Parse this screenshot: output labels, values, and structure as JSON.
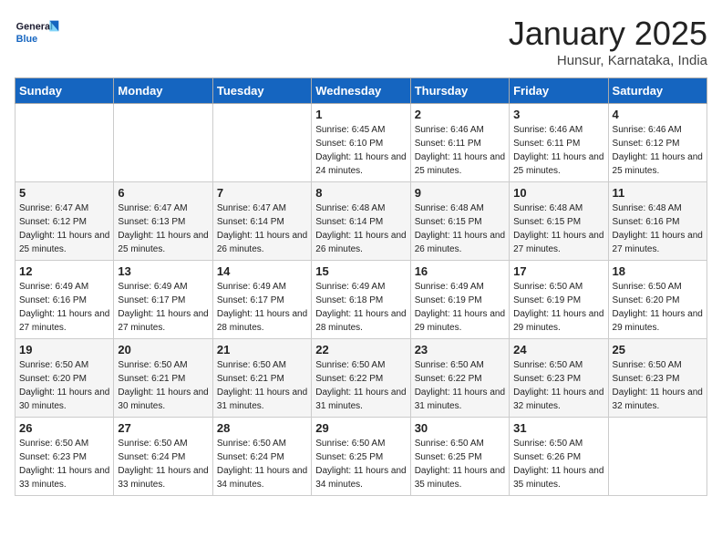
{
  "header": {
    "logo_general": "General",
    "logo_blue": "Blue",
    "month": "January 2025",
    "location": "Hunsur, Karnataka, India"
  },
  "weekdays": [
    "Sunday",
    "Monday",
    "Tuesday",
    "Wednesday",
    "Thursday",
    "Friday",
    "Saturday"
  ],
  "weeks": [
    [
      {
        "day": "",
        "info": ""
      },
      {
        "day": "",
        "info": ""
      },
      {
        "day": "",
        "info": ""
      },
      {
        "day": "1",
        "info": "Sunrise: 6:45 AM\nSunset: 6:10 PM\nDaylight: 11 hours and 24 minutes."
      },
      {
        "day": "2",
        "info": "Sunrise: 6:46 AM\nSunset: 6:11 PM\nDaylight: 11 hours and 25 minutes."
      },
      {
        "day": "3",
        "info": "Sunrise: 6:46 AM\nSunset: 6:11 PM\nDaylight: 11 hours and 25 minutes."
      },
      {
        "day": "4",
        "info": "Sunrise: 6:46 AM\nSunset: 6:12 PM\nDaylight: 11 hours and 25 minutes."
      }
    ],
    [
      {
        "day": "5",
        "info": "Sunrise: 6:47 AM\nSunset: 6:12 PM\nDaylight: 11 hours and 25 minutes."
      },
      {
        "day": "6",
        "info": "Sunrise: 6:47 AM\nSunset: 6:13 PM\nDaylight: 11 hours and 25 minutes."
      },
      {
        "day": "7",
        "info": "Sunrise: 6:47 AM\nSunset: 6:14 PM\nDaylight: 11 hours and 26 minutes."
      },
      {
        "day": "8",
        "info": "Sunrise: 6:48 AM\nSunset: 6:14 PM\nDaylight: 11 hours and 26 minutes."
      },
      {
        "day": "9",
        "info": "Sunrise: 6:48 AM\nSunset: 6:15 PM\nDaylight: 11 hours and 26 minutes."
      },
      {
        "day": "10",
        "info": "Sunrise: 6:48 AM\nSunset: 6:15 PM\nDaylight: 11 hours and 27 minutes."
      },
      {
        "day": "11",
        "info": "Sunrise: 6:48 AM\nSunset: 6:16 PM\nDaylight: 11 hours and 27 minutes."
      }
    ],
    [
      {
        "day": "12",
        "info": "Sunrise: 6:49 AM\nSunset: 6:16 PM\nDaylight: 11 hours and 27 minutes."
      },
      {
        "day": "13",
        "info": "Sunrise: 6:49 AM\nSunset: 6:17 PM\nDaylight: 11 hours and 27 minutes."
      },
      {
        "day": "14",
        "info": "Sunrise: 6:49 AM\nSunset: 6:17 PM\nDaylight: 11 hours and 28 minutes."
      },
      {
        "day": "15",
        "info": "Sunrise: 6:49 AM\nSunset: 6:18 PM\nDaylight: 11 hours and 28 minutes."
      },
      {
        "day": "16",
        "info": "Sunrise: 6:49 AM\nSunset: 6:19 PM\nDaylight: 11 hours and 29 minutes."
      },
      {
        "day": "17",
        "info": "Sunrise: 6:50 AM\nSunset: 6:19 PM\nDaylight: 11 hours and 29 minutes."
      },
      {
        "day": "18",
        "info": "Sunrise: 6:50 AM\nSunset: 6:20 PM\nDaylight: 11 hours and 29 minutes."
      }
    ],
    [
      {
        "day": "19",
        "info": "Sunrise: 6:50 AM\nSunset: 6:20 PM\nDaylight: 11 hours and 30 minutes."
      },
      {
        "day": "20",
        "info": "Sunrise: 6:50 AM\nSunset: 6:21 PM\nDaylight: 11 hours and 30 minutes."
      },
      {
        "day": "21",
        "info": "Sunrise: 6:50 AM\nSunset: 6:21 PM\nDaylight: 11 hours and 31 minutes."
      },
      {
        "day": "22",
        "info": "Sunrise: 6:50 AM\nSunset: 6:22 PM\nDaylight: 11 hours and 31 minutes."
      },
      {
        "day": "23",
        "info": "Sunrise: 6:50 AM\nSunset: 6:22 PM\nDaylight: 11 hours and 31 minutes."
      },
      {
        "day": "24",
        "info": "Sunrise: 6:50 AM\nSunset: 6:23 PM\nDaylight: 11 hours and 32 minutes."
      },
      {
        "day": "25",
        "info": "Sunrise: 6:50 AM\nSunset: 6:23 PM\nDaylight: 11 hours and 32 minutes."
      }
    ],
    [
      {
        "day": "26",
        "info": "Sunrise: 6:50 AM\nSunset: 6:23 PM\nDaylight: 11 hours and 33 minutes."
      },
      {
        "day": "27",
        "info": "Sunrise: 6:50 AM\nSunset: 6:24 PM\nDaylight: 11 hours and 33 minutes."
      },
      {
        "day": "28",
        "info": "Sunrise: 6:50 AM\nSunset: 6:24 PM\nDaylight: 11 hours and 34 minutes."
      },
      {
        "day": "29",
        "info": "Sunrise: 6:50 AM\nSunset: 6:25 PM\nDaylight: 11 hours and 34 minutes."
      },
      {
        "day": "30",
        "info": "Sunrise: 6:50 AM\nSunset: 6:25 PM\nDaylight: 11 hours and 35 minutes."
      },
      {
        "day": "31",
        "info": "Sunrise: 6:50 AM\nSunset: 6:26 PM\nDaylight: 11 hours and 35 minutes."
      },
      {
        "day": "",
        "info": ""
      }
    ]
  ]
}
